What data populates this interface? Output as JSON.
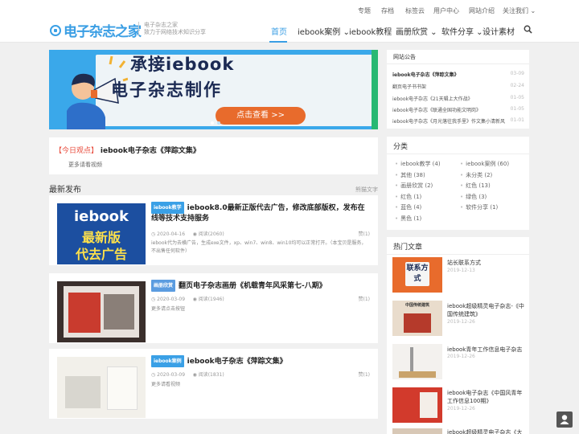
{
  "topbar": {
    "links": [
      "专题",
      "存档",
      "标签云",
      "用户中心",
      "网站介绍",
      "关注我们 ⌄"
    ]
  },
  "logo": {
    "text": "电子杂志之家",
    "slogan_line1": "电子杂志之家",
    "slogan_line2": "致力于网络技术知识分享"
  },
  "nav": {
    "items": [
      "首页",
      "iebook案例 ⌄",
      "iebook教程",
      "画册欣赏 ⌄",
      "软件分享 ⌄",
      "设计素材"
    ],
    "active_index": 0
  },
  "banner": {
    "line1": "承接iebook",
    "line2": "电子杂志制作",
    "button": "点击查看 >>"
  },
  "today": {
    "prefix": "【今日观点】",
    "title": "iebook电子杂志《萍踪文集》",
    "desc": "更多请看视频"
  },
  "latest": {
    "title": "最新发布",
    "more": "熊猫文字"
  },
  "posts": [
    {
      "tag": "iebook教学",
      "title": "iebook8.0最新正版代去广告，修改底部版权，发布在线等技术支持服务",
      "date": "2020-04-16",
      "views": "阅读(2060)",
      "excerpt": "iebook代为去横广告，生成exe文件，xp、win7、win8、win10均可以正常打开。（本宝贝是服务，不出售任何软件）",
      "likes": "赞(1)",
      "thumb_text1": "iebook",
      "thumb_text2": "最新版",
      "thumb_text3": "代去广告"
    },
    {
      "tag": "画册欣赏",
      "title": "翻页电子杂志画册《机载青年风采第七-八期》",
      "date": "2020-03-09",
      "views": "阅读(1946)",
      "excerpt": "更多请点击按钮",
      "likes": "赞(1)"
    },
    {
      "tag": "iebook案例",
      "title": "iebook电子杂志《萍踪文集》",
      "date": "2020-03-09",
      "views": "阅读(1831)",
      "excerpt": "更多请看视频",
      "likes": "赞(1)"
    }
  ],
  "notice": {
    "title": "网站公告",
    "items": [
      {
        "text": "iebook电子杂志《萍踪文集》",
        "date": "03-09"
      },
      {
        "text": "翻页电子书书架",
        "date": "02-24"
      },
      {
        "text": "iebook电子杂志《21天辑上大作战》",
        "date": "01-05"
      },
      {
        "text": "iebook电子杂志《联通全国功能文明岗》",
        "date": "01-05"
      },
      {
        "text": "iebook电子杂志《月光落往我手里》作文集小清新风格",
        "date": "01-01"
      }
    ]
  },
  "categories": {
    "title": "分类",
    "left": [
      "iebook教学 (4)",
      "其他 (38)",
      "画册欣赏 (2)",
      "红色 (1)",
      "蓝色 (4)",
      "黑色 (1)"
    ],
    "right": [
      "iebook案例 (60)",
      "未分类 (2)",
      "红色 (13)",
      "绿色 (3)",
      "软件分享 (1)"
    ]
  },
  "hot": {
    "title": "热门文章",
    "items": [
      {
        "title": "站长联系方式",
        "date": "2019-12-13",
        "thumb": "联系方式"
      },
      {
        "title": "iebook超级精灵电子杂志-《中国传统建筑》",
        "date": "2019-12-26",
        "thumb": "中国传统建筑"
      },
      {
        "title": "iebook青年工作信息电子杂志",
        "date": "2019-12-26",
        "thumb": ""
      },
      {
        "title": "iebook电子杂志《中国风青年工作信息100期》",
        "date": "2019-12-26",
        "thumb": ""
      },
      {
        "title": "iebook超级精灵电子杂志《大数",
        "date": "",
        "thumb": ""
      }
    ]
  },
  "colors": {
    "accent": "#3a9ee4",
    "banner_bg": "#3aa8ea",
    "button": "#e86b2c",
    "today_prefix": "#e84c3d"
  }
}
